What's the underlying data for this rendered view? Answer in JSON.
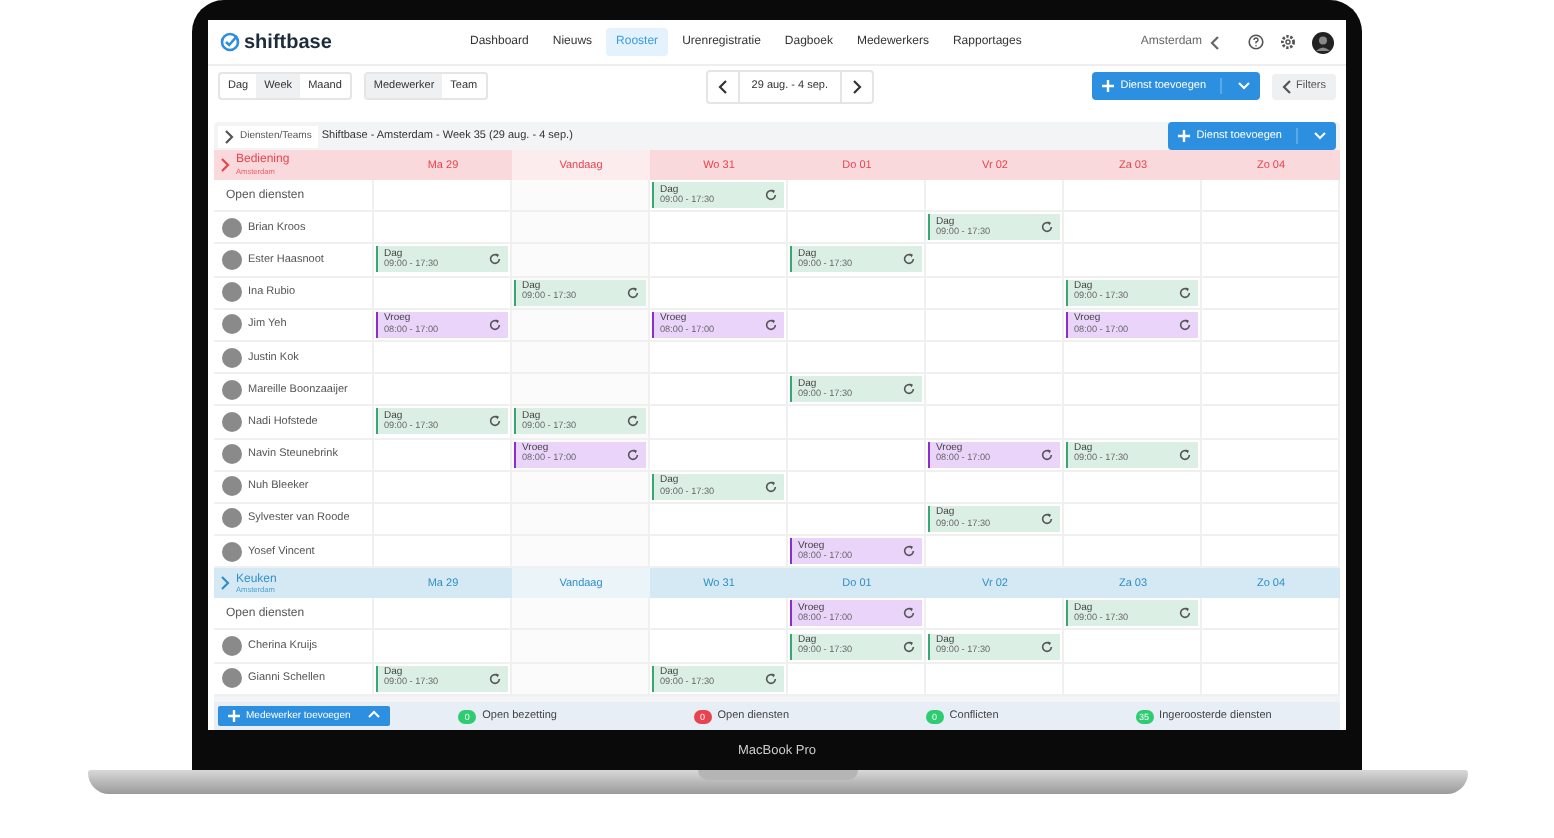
{
  "logo": {
    "text": "shiftbase"
  },
  "nav": {
    "items": [
      {
        "label": "Dashboard",
        "selected": false
      },
      {
        "label": "Nieuws",
        "selected": false
      },
      {
        "label": "Rooster",
        "selected": true
      },
      {
        "label": "Urenregistratie",
        "selected": false
      },
      {
        "label": "Dagboek",
        "selected": false
      },
      {
        "label": "Medewerkers",
        "selected": false
      },
      {
        "label": "Rapportages",
        "selected": false
      }
    ],
    "location": "Amsterdam"
  },
  "toolbar": {
    "periods": [
      {
        "label": "Dag",
        "selected": false
      },
      {
        "label": "Week",
        "selected": true
      },
      {
        "label": "Maand",
        "selected": false
      }
    ],
    "groupings": [
      {
        "label": "Medewerker",
        "selected": true
      },
      {
        "label": "Team",
        "selected": false
      }
    ],
    "date_range": "29 aug. - 4 sep.",
    "add_button": "Dienst toevoegen",
    "filters": "Filters"
  },
  "panel": {
    "toggle": "Diensten/Teams",
    "title": "Shiftbase - Amsterdam - Week 35 (29 aug. - 4 sep.)",
    "add_button": "Dienst toevoegen"
  },
  "teams": [
    {
      "name": "Bediening",
      "location": "Amsterdam",
      "color": "#e8434f",
      "days": [
        {
          "label": "Ma 29",
          "today": false
        },
        {
          "label": "Vandaag",
          "today": true
        },
        {
          "label": "Wo 31",
          "today": false
        },
        {
          "label": "Do 01",
          "today": false
        },
        {
          "label": "Vr 02",
          "today": false
        },
        {
          "label": "Za 03",
          "today": false
        },
        {
          "label": "Zo 04",
          "today": false
        }
      ],
      "rows": [
        {
          "kind": "open",
          "name": "Open diensten",
          "cells": [
            null,
            null,
            {
              "kind": "dag",
              "label": "Dag",
              "time": "09:00 - 17:30"
            },
            null,
            null,
            null,
            null
          ]
        },
        {
          "kind": "employee",
          "name": "Brian Kroos",
          "cells": [
            null,
            null,
            null,
            null,
            {
              "kind": "dag",
              "label": "Dag",
              "time": "09:00 - 17:30"
            },
            null,
            null
          ]
        },
        {
          "kind": "employee",
          "name": "Ester Haasnoot",
          "cells": [
            {
              "kind": "dag",
              "label": "Dag",
              "time": "09:00 - 17:30"
            },
            null,
            null,
            {
              "kind": "dag",
              "label": "Dag",
              "time": "09:00 - 17:30"
            },
            null,
            null,
            null
          ]
        },
        {
          "kind": "employee",
          "name": "Ina Rubio",
          "cells": [
            null,
            {
              "kind": "dag",
              "label": "Dag",
              "time": "09:00 - 17:30"
            },
            null,
            null,
            null,
            {
              "kind": "dag",
              "label": "Dag",
              "time": "09:00 - 17:30"
            },
            null
          ]
        },
        {
          "kind": "employee",
          "name": "Jim Yeh",
          "cells": [
            {
              "kind": "vroeg",
              "label": "Vroeg",
              "time": "08:00 - 17:00"
            },
            null,
            {
              "kind": "vroeg",
              "label": "Vroeg",
              "time": "08:00 - 17:00"
            },
            null,
            null,
            {
              "kind": "vroeg",
              "label": "Vroeg",
              "time": "08:00 - 17:00"
            },
            null
          ]
        },
        {
          "kind": "employee",
          "name": "Justin Kok",
          "cells": [
            null,
            null,
            null,
            null,
            null,
            null,
            null
          ]
        },
        {
          "kind": "employee",
          "name": "Mareille Boonzaaijer",
          "cells": [
            null,
            null,
            null,
            {
              "kind": "dag",
              "label": "Dag",
              "time": "09:00 - 17:30"
            },
            null,
            null,
            null
          ]
        },
        {
          "kind": "employee",
          "name": "Nadi Hofstede",
          "cells": [
            {
              "kind": "dag",
              "label": "Dag",
              "time": "09:00 - 17:30"
            },
            {
              "kind": "dag",
              "label": "Dag",
              "time": "09:00 - 17:30"
            },
            null,
            null,
            null,
            null,
            null
          ]
        },
        {
          "kind": "employee",
          "name": "Navin Steunebrink",
          "cells": [
            null,
            {
              "kind": "vroeg",
              "label": "Vroeg",
              "time": "08:00 - 17:00"
            },
            null,
            null,
            {
              "kind": "vroeg",
              "label": "Vroeg",
              "time": "08:00 - 17:00"
            },
            {
              "kind": "dag",
              "label": "Dag",
              "time": "09:00 - 17:30"
            },
            null
          ]
        },
        {
          "kind": "employee",
          "name": "Nuh Bleeker",
          "cells": [
            null,
            null,
            {
              "kind": "dag",
              "label": "Dag",
              "time": "09:00 - 17:30"
            },
            null,
            null,
            null,
            null
          ]
        },
        {
          "kind": "employee",
          "name": "Sylvester van Roode",
          "cells": [
            null,
            null,
            null,
            null,
            {
              "kind": "dag",
              "label": "Dag",
              "time": "09:00 - 17:30"
            },
            null,
            null
          ]
        },
        {
          "kind": "employee",
          "name": "Yosef Vincent",
          "cells": [
            null,
            null,
            null,
            {
              "kind": "vroeg",
              "label": "Vroeg",
              "time": "08:00 - 17:00"
            },
            null,
            null,
            null
          ]
        }
      ]
    },
    {
      "name": "Keuken",
      "location": "Amsterdam",
      "color": "#2f8fc8",
      "days": [
        {
          "label": "Ma 29",
          "today": false
        },
        {
          "label": "Vandaag",
          "today": true
        },
        {
          "label": "Wo 31",
          "today": false
        },
        {
          "label": "Do 01",
          "today": false
        },
        {
          "label": "Vr 02",
          "today": false
        },
        {
          "label": "Za 03",
          "today": false
        },
        {
          "label": "Zo 04",
          "today": false
        }
      ],
      "rows": [
        {
          "kind": "open",
          "name": "Open diensten",
          "cells": [
            null,
            null,
            null,
            {
              "kind": "vroeg",
              "label": "Vroeg",
              "time": "08:00 - 17:00"
            },
            null,
            {
              "kind": "dag",
              "label": "Dag",
              "time": "09:00 - 17:30"
            },
            null
          ]
        },
        {
          "kind": "employee",
          "name": "Cherina Kruijs",
          "cells": [
            null,
            null,
            null,
            {
              "kind": "dag",
              "label": "Dag",
              "time": "09:00 - 17:30"
            },
            {
              "kind": "dag",
              "label": "Dag",
              "time": "09:00 - 17:30"
            },
            null,
            null
          ]
        },
        {
          "kind": "employee",
          "name": "Gianni Schellen",
          "cells": [
            {
              "kind": "dag",
              "label": "Dag",
              "time": "09:00 - 17:30"
            },
            null,
            {
              "kind": "dag",
              "label": "Dag",
              "time": "09:00 - 17:30"
            },
            null,
            null,
            null,
            null
          ]
        }
      ]
    }
  ],
  "footer": {
    "add_button": "Medewerker toevoegen",
    "stats": [
      {
        "count": "0",
        "label": "Open bezetting",
        "color": "#2ecc71"
      },
      {
        "count": "0",
        "label": "Open diensten",
        "color": "#e8434f"
      },
      {
        "count": "0",
        "label": "Conflicten",
        "color": "#2ecc71"
      },
      {
        "count": "35",
        "label": "Ingeroosterde diensten",
        "color": "#2ecc71"
      }
    ]
  },
  "device": {
    "label": "MacBook Pro"
  }
}
